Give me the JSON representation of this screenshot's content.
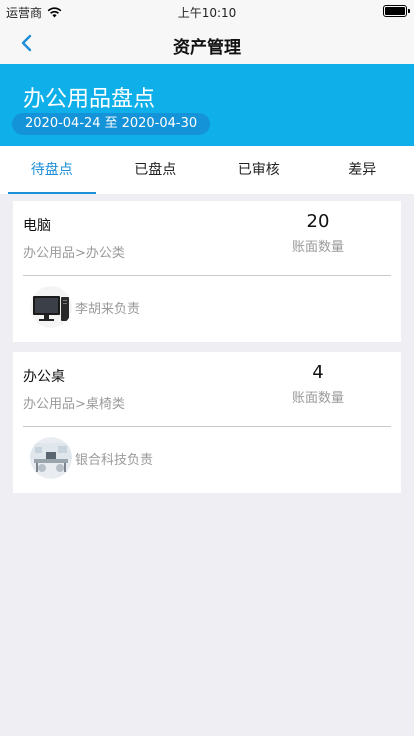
{
  "status_bar": {
    "carrier": "运营商",
    "time": "上午10:10"
  },
  "nav": {
    "title": "资产管理",
    "back_icon": "chevron-left-icon"
  },
  "banner": {
    "heading": "办公用品盘点",
    "start_date": "2020-04-24",
    "separator": "至",
    "end_date": "2020-04-30"
  },
  "tabs": [
    {
      "label": "待盘点",
      "active": true
    },
    {
      "label": "已盘点",
      "active": false
    },
    {
      "label": "已审核",
      "active": false
    },
    {
      "label": "差异",
      "active": false
    }
  ],
  "assets": [
    {
      "name": "电脑",
      "category": "办公用品>办公类",
      "quantity": "20",
      "quantity_label": "账面数量",
      "owner": "李胡来负责",
      "thumb_icon": "desktop-computer-icon"
    },
    {
      "name": "办公桌",
      "category": "办公用品>桌椅类",
      "quantity": "4",
      "quantity_label": "账面数量",
      "owner": "银合科技负责",
      "thumb_icon": "office-room-icon"
    }
  ],
  "colors": {
    "accent": "#1d8fd9",
    "banner": "#0fb0ea",
    "pill": "#1593d8",
    "background": "#eeeef3"
  }
}
